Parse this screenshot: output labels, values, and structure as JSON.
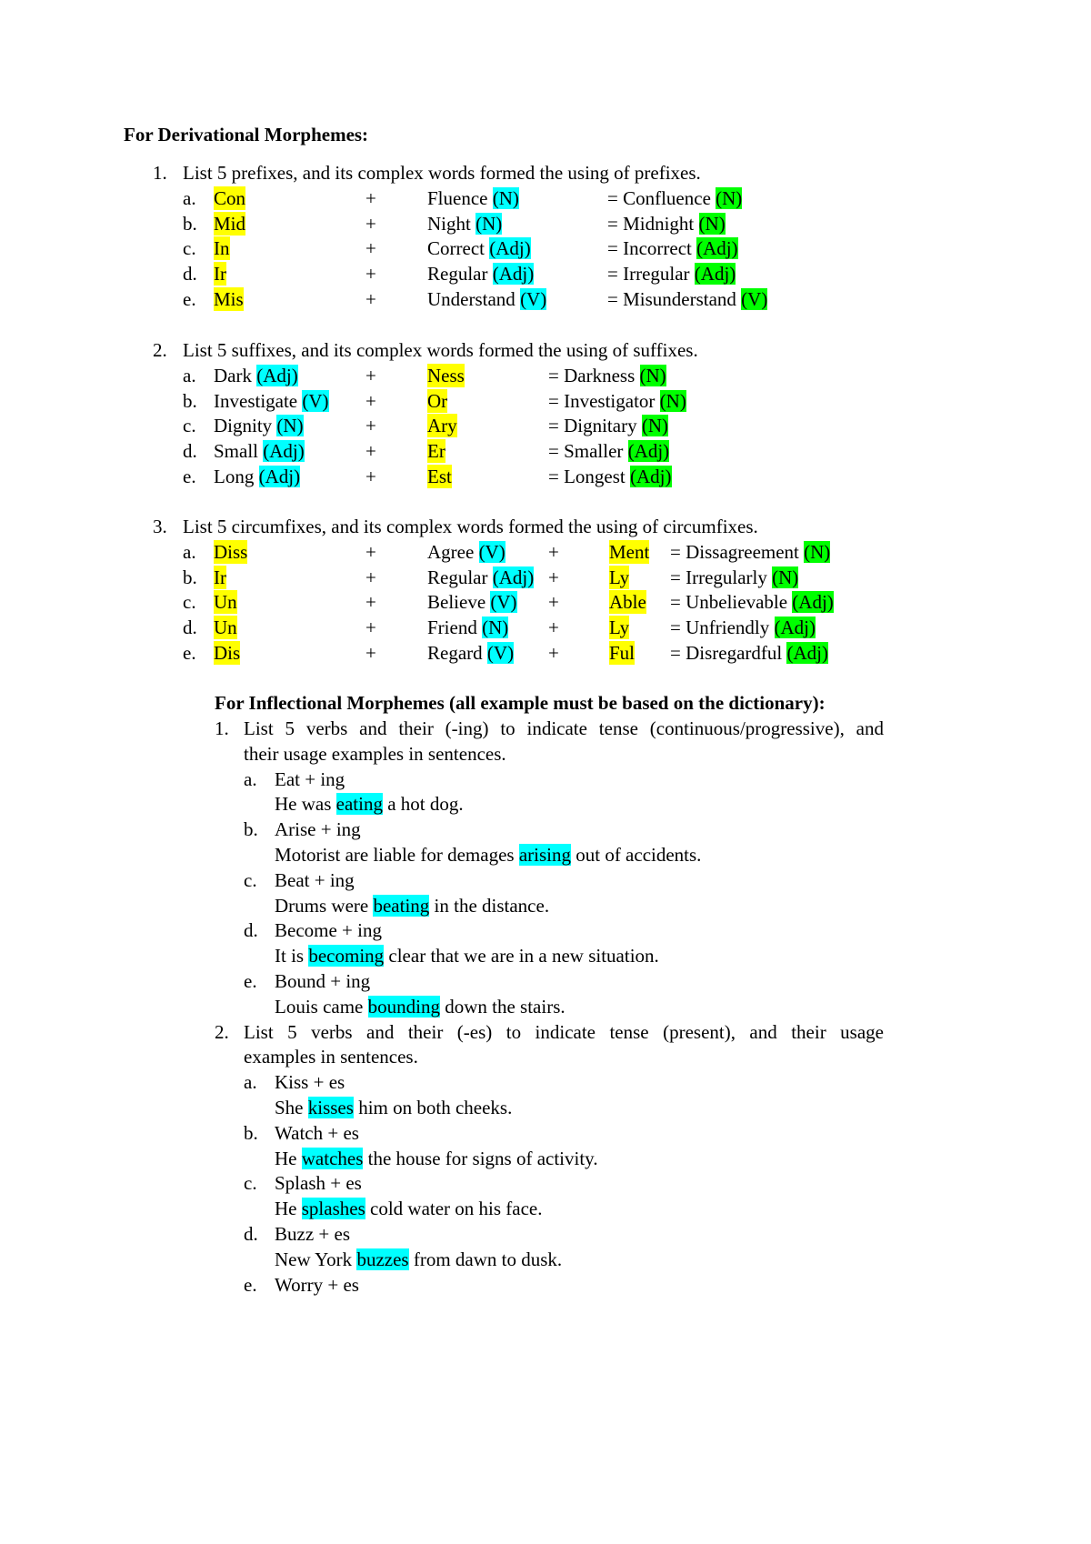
{
  "colors": {
    "prefix_suffix_highlight": "#ffff00",
    "base_class_highlight": "#00ffff",
    "result_class_highlight": "#00ff00"
  },
  "derivational": {
    "heading": "For Derivational Morphemes:",
    "sections": [
      {
        "number": "1.",
        "title": "List 5 prefixes, and its complex words formed the using of prefixes.",
        "rows": [
          {
            "letter": "a.",
            "prefix": "Con",
            "plus": "+",
            "base": "Fluence ",
            "base_class": "(N)",
            "result": "= Confluence ",
            "result_class": "(N)"
          },
          {
            "letter": "b.",
            "prefix": "Mid",
            "plus": "+",
            "base": "Night ",
            "base_class": "(N)",
            "result": "= Midnight ",
            "result_class": "(N)"
          },
          {
            "letter": "c.",
            "prefix": "In",
            "plus": "+",
            "base": "Correct ",
            "base_class": "(Adj)",
            "result": "= Incorrect ",
            "result_class": "(Adj)"
          },
          {
            "letter": "d.",
            "prefix": "Ir",
            "plus": "+",
            "base": "Regular ",
            "base_class": "(Adj)",
            "result": "= Irregular ",
            "result_class": "(Adj)"
          },
          {
            "letter": "e.",
            "prefix": "Mis",
            "plus": "+",
            "base": "Understand ",
            "base_class": "(V)",
            "result": "= Misunderstand ",
            "result_class": "(V)"
          }
        ]
      },
      {
        "number": "2.",
        "title": "List 5 suffixes, and its complex words formed the using of suffixes.",
        "rows": [
          {
            "letter": "a.",
            "base": "Dark ",
            "base_class": "(Adj)",
            "plus": "+",
            "suffix": "Ness",
            "result": "= Darkness ",
            "result_class": "(N)"
          },
          {
            "letter": "b.",
            "base": "Investigate ",
            "base_class": "(V)",
            "plus": "+",
            "suffix": "Or",
            "result": "= Investigator ",
            "result_class": "(N)"
          },
          {
            "letter": "c.",
            "base": "Dignity ",
            "base_class": "(N)",
            "plus": "+",
            "suffix": "Ary",
            "result": "= Dignitary ",
            "result_class": "(N)"
          },
          {
            "letter": "d.",
            "base": "Small ",
            "base_class": "(Adj)",
            "plus": "+",
            "suffix": "Er",
            "result": "= Smaller ",
            "result_class": "(Adj)"
          },
          {
            "letter": "e.",
            "base": "Long ",
            "base_class": "(Adj)",
            "plus": "+",
            "suffix": "Est",
            "result": "= Longest ",
            "result_class": "(Adj)"
          }
        ]
      },
      {
        "number": "3.",
        "title": "List 5 circumfixes, and its complex words formed the using of circumfixes.",
        "rows": [
          {
            "letter": "a.",
            "prefix": "Diss",
            "plus1": "+",
            "base": "Agree ",
            "base_class": "(V)",
            "plus2": "+",
            "suffix": "Ment",
            "result": "= Dissagreement ",
            "result_class": "(N)"
          },
          {
            "letter": "b.",
            "prefix": "Ir",
            "plus1": "+",
            "base": "Regular ",
            "base_class": "(Adj)",
            "plus2": "+",
            "suffix": "Ly",
            "result": "= Irregularly ",
            "result_class": "(N)"
          },
          {
            "letter": "c.",
            "prefix": "Un",
            "plus1": "+",
            "base": "Believe ",
            "base_class": "(V)",
            "plus2": "+",
            "suffix": "Able",
            "result": "= Unbelievable ",
            "result_class": "(Adj)"
          },
          {
            "letter": "d.",
            "prefix": "Un",
            "plus1": "+",
            "base": "Friend ",
            "base_class": "(N)",
            "plus2": "+",
            "suffix": "Ly",
            "result": "= Unfriendly ",
            "result_class": "(Adj)"
          },
          {
            "letter": "e.",
            "prefix": "Dis",
            "plus1": "+",
            "base": "Regard ",
            "base_class": "(V)",
            "plus2": "+",
            "suffix": "Ful",
            "result": "= Disregardful ",
            "result_class": "(Adj)"
          }
        ]
      }
    ]
  },
  "inflectional": {
    "heading": "For Inflectional Morphemes (all example must be based on the dictionary):",
    "sections": [
      {
        "number": "1.",
        "title_line1": "List 5 verbs and their (-ing) to indicate tense (continuous/progressive), and",
        "title_line2": "their usage examples in sentences.",
        "items": [
          {
            "letter": "a.",
            "formula": "Eat + ing",
            "before": "He was ",
            "word": "eating",
            "after": " a hot dog."
          },
          {
            "letter": "b.",
            "formula": "Arise + ing",
            "before": "Motorist are liable for demages ",
            "word": "arising",
            "after": " out of accidents."
          },
          {
            "letter": "c.",
            "formula": "Beat + ing",
            "before": "Drums were ",
            "word": "beating",
            "after": " in the distance."
          },
          {
            "letter": "d.",
            "formula": "Become + ing",
            "before": "It is ",
            "word": "becoming",
            "after": " clear that we are in a new situation."
          },
          {
            "letter": "e.",
            "formula": "Bound + ing",
            "before": "Louis came ",
            "word": "bounding",
            "after": " down the stairs."
          }
        ]
      },
      {
        "number": "2.",
        "title_line1": "List 5 verbs and their  (-es) to indicate tense (present), and their usage",
        "title_line2": "examples in sentences.",
        "items": [
          {
            "letter": "a.",
            "formula": "Kiss + es",
            "before": "She ",
            "word": "kisses",
            "after": " him on both cheeks."
          },
          {
            "letter": "b.",
            "formula": "Watch + es",
            "before": "He ",
            "word": "watches",
            "after": " the house for signs of activity."
          },
          {
            "letter": "c.",
            "formula": "Splash + es",
            "before": "He ",
            "word": "splashes",
            "after": " cold water on his face."
          },
          {
            "letter": "d.",
            "formula": "Buzz + es",
            "before": "New York ",
            "word": "buzzes",
            "after": " from dawn to dusk."
          },
          {
            "letter": "e.",
            "formula": "Worry + es"
          }
        ]
      }
    ]
  }
}
